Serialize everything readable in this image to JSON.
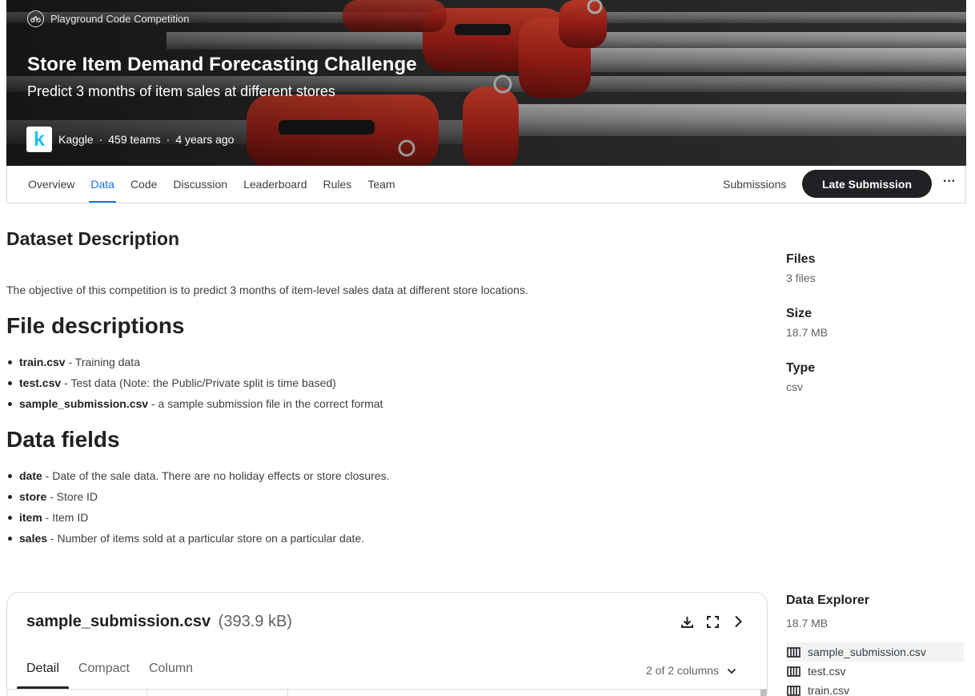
{
  "hero": {
    "competition_type": "Playground Code Competition",
    "title": "Store Item Demand Forecasting Challenge",
    "subtitle": "Predict 3 months of item sales at different stores",
    "host": "Kaggle",
    "teams": "459 teams",
    "age": "4 years ago",
    "logo_letter": "k"
  },
  "nav": {
    "tabs": [
      "Overview",
      "Data",
      "Code",
      "Discussion",
      "Leaderboard",
      "Rules",
      "Team"
    ],
    "active_tab": "Data",
    "submissions_label": "Submissions",
    "late_submission_label": "Late Submission",
    "more_label": "···"
  },
  "content": {
    "title": "Dataset Description",
    "description": "The objective of this competition is to predict 3 months of item-level sales data at different store locations.",
    "file_descriptions_heading": "File descriptions",
    "files": [
      {
        "name": "train.csv",
        "desc": " - Training data"
      },
      {
        "name": "test.csv",
        "desc": " - Test data (Note: the Public/Private split is time based)"
      },
      {
        "name": "sample_submission.csv",
        "desc": " - a sample submission file in the correct format"
      }
    ],
    "data_fields_heading": "Data fields",
    "fields": [
      {
        "name": "date",
        "desc": " - Date of the sale data. There are no holiday effects or store closures."
      },
      {
        "name": "store",
        "desc": " - Store ID"
      },
      {
        "name": "item",
        "desc": " - Item ID"
      },
      {
        "name": "sales",
        "desc": " - Number of items sold at a particular store on a particular date."
      }
    ]
  },
  "sidebar": {
    "files_label": "Files",
    "files_value": "3 files",
    "size_label": "Size",
    "size_value": "18.7 MB",
    "type_label": "Type",
    "type_value": "csv"
  },
  "preview": {
    "file_name": "sample_submission.csv",
    "file_size": "(393.9 kB)",
    "tabs": [
      "Detail",
      "Compact",
      "Column"
    ],
    "active_tab": "Detail",
    "columns_label": "2 of 2 columns",
    "icons": [
      "download-icon",
      "fullscreen-icon",
      "chevron-right-icon"
    ]
  },
  "explorer": {
    "title": "Data Explorer",
    "size": "18.7 MB",
    "files": [
      "sample_submission.csv",
      "test.csv",
      "train.csv"
    ],
    "selected": "sample_submission.csv"
  },
  "colors": {
    "accent": "#1a73e8",
    "dark_button": "#202124",
    "kaggle_blue": "#20beff",
    "hero_red": "#c4281c"
  }
}
